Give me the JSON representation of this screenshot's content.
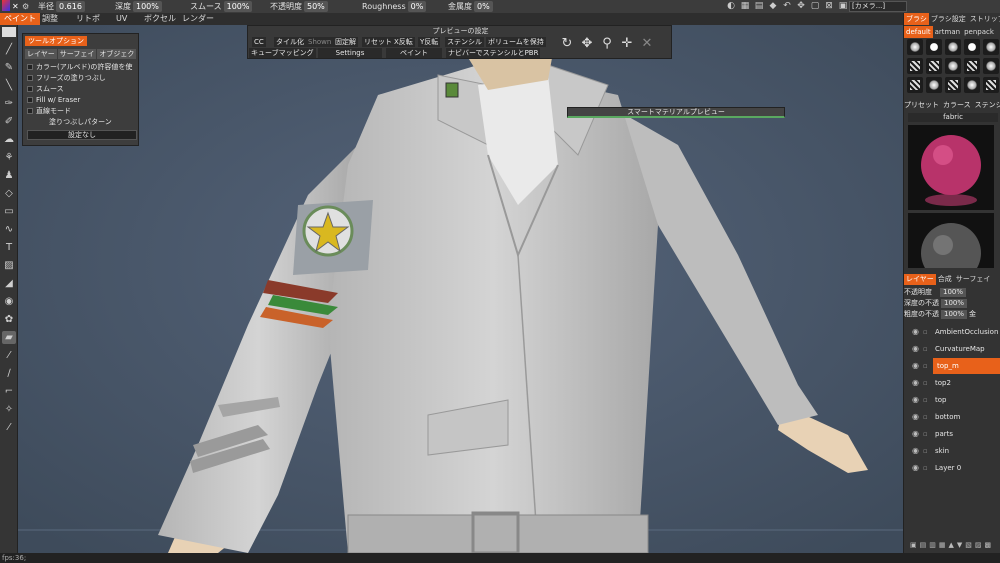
{
  "topbar": {
    "radius_label": "半径",
    "radius_value": "0.616",
    "depth_label": "深度",
    "depth_value": "100%",
    "smooth_label": "スムース",
    "smooth_value": "100%",
    "opacity_label": "不透明度",
    "opacity_value": "50%",
    "roughness_label": "Roughness",
    "roughness_value": "0%",
    "metal_label": "金属度",
    "metal_value": "0%",
    "camera_select": "[カメラ...]",
    "modes": [
      "ペイント",
      "調整",
      "リトポ",
      "UV",
      "ボクセル",
      "レンダー"
    ],
    "active_mode": 0
  },
  "tool_options": {
    "header": "ツールオプション",
    "tabs": [
      "レイヤー",
      "サーフェイ",
      "オブジェク"
    ],
    "options": [
      "カラー(アルベド)の許容値を使",
      "フリーズの塗りつぶし",
      "スムース",
      "Fill w/ Eraser",
      "直線モード",
      "塗りつぶしパターン"
    ],
    "select_value": "設定なし"
  },
  "preview": {
    "title": "プレビューの設定",
    "row1": [
      "CC",
      "タイル化",
      "Shown",
      "固定解",
      "リセット",
      "X反転",
      "Y反転",
      "ステンシル",
      "ボリュームを保持"
    ],
    "row2": [
      "キューブマッピング",
      "Settings",
      "ペイント",
      "ナビバーでステンシルとPBR"
    ]
  },
  "smart_material": "スマートマテリアルプレビュー",
  "right": {
    "tabs": [
      "ブラシ",
      "ブラシ設定",
      "ストリップ"
    ],
    "brush_tabs": [
      "default",
      "artman",
      "penpack"
    ],
    "preset_tabs": [
      "プリセット",
      "カラース",
      "ステンシ"
    ],
    "material_category": "fabric",
    "layer_tabs": [
      "レイヤー",
      "合成",
      "サーフェイ"
    ],
    "sliders": [
      {
        "label": "不透明度",
        "value": "100%"
      },
      {
        "label": "深度の不透",
        "value": "100%"
      },
      {
        "label": "粗度の不透",
        "value": "100%",
        "extra": "金"
      }
    ],
    "layers": [
      "AmbientOcclusion",
      "CurvatureMap",
      "top_m",
      "top2",
      "top",
      "bottom",
      "parts",
      "skin",
      "Layer 0"
    ],
    "active_layer": 2
  },
  "status": "fps:36;",
  "colors": {
    "accent": "#e8611a",
    "viewport": "#4b5a6c"
  }
}
